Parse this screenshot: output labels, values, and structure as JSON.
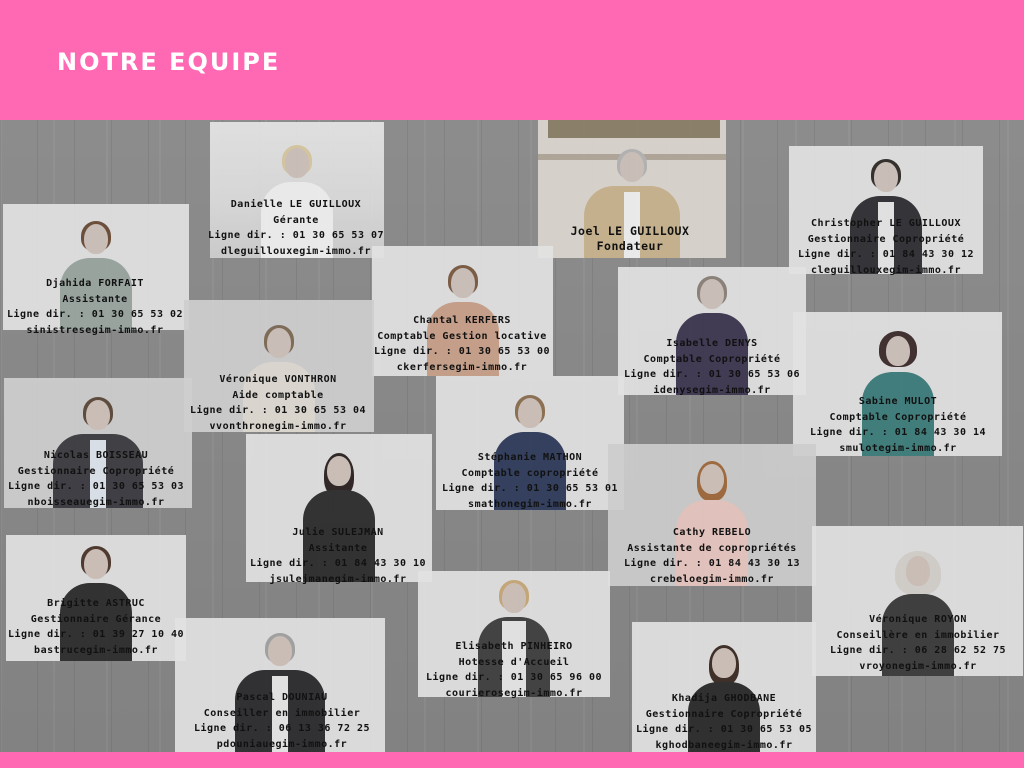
{
  "header": {
    "title": "NOTRE EQUIPE"
  },
  "team": [
    {
      "name": "Danielle LE GUILLOUX",
      "role": "Gérante",
      "phone": "Ligne dir. : 01 30 65 53 07",
      "email": "dleguillouxegim-immo.fr"
    },
    {
      "name": "Joel LE GUILLOUX",
      "role": "Fondateur"
    },
    {
      "name": "Christopher LE GUILLOUX",
      "role": "Gestionnaire Copropriété",
      "phone": "Ligne dir. : 01 84 43 30 12",
      "email": "cleguillouxegim-immo.fr"
    },
    {
      "name": "Djahida FORFAIT",
      "role": "Assistante",
      "phone": "Ligne dir. : 01 30 65 53 02",
      "email": "sinistresegim-immo.fr"
    },
    {
      "name": "Chantal KERFERS",
      "role": "Comptable Gestion locative",
      "phone": "Ligne dir. : 01 30 65 53 00",
      "email": "ckerfersegim-immo.fr"
    },
    {
      "name": "Isabelle DENYS",
      "role": "Comptable Copropriété",
      "phone": "Ligne dir. : 01 30 65 53 06",
      "email": "idenysegim-immo.fr"
    },
    {
      "name": "Véronique VONTHRON",
      "role": "Aide comptable",
      "phone": "Ligne dir. : 01 30 65 53 04",
      "email": "vvonthronegim-immo.fr"
    },
    {
      "name": "Sabine MULOT",
      "role": "Comptable Copropriété",
      "phone": "Ligne dir. : 01 84 43 30 14",
      "email": "smulotegim-immo.fr"
    },
    {
      "name": "Nicolas BOISSEAU",
      "role": "Gestionnaire Copropriété",
      "phone": "Ligne dir. : 01 30 65 53 03",
      "email": "nboisseauegim-immo.fr"
    },
    {
      "name": "Stéphanie MATHON",
      "role": "Comptable copropriété",
      "phone": "Ligne dir. : 01 30 65 53 01",
      "email": "smathonegim-immo.fr"
    },
    {
      "name": "Julie SULEJMAN",
      "role": "Assitante",
      "phone": "Ligne dir. : 01 84 43 30 10",
      "email": "jsulejmanegim-immo.fr"
    },
    {
      "name": "Cathy REBELO",
      "role": "Assistante de copropriétés",
      "phone": "Ligne dir. : 01 84 43 30 13",
      "email": "crebeloegim-immo.fr"
    },
    {
      "name": "Brigitte ASTRUC",
      "role": "Gestionnaire Gérance",
      "phone": "Ligne dir. : 01 39 27 10 40",
      "email": "bastrucegim-immo.fr"
    },
    {
      "name": "Véronique ROYON",
      "role": "Conseillère en immobilier",
      "phone": "Ligne dir. : 06 28 62 52 75",
      "email": "vroyonegim-immo.fr"
    },
    {
      "name": "Elisabeth PINHEIRO",
      "role": "Hotesse d'Accueil",
      "phone": "Ligne dir. : 01 30 65 96 00",
      "email": "courierosegim-immo.fr"
    },
    {
      "name": "Pascal DOUNIAU",
      "role": "Conseiller en immobilier",
      "phone": "Ligne dir. : 06 13 36 72 25",
      "email": "pdouniauegim-immo.fr"
    },
    {
      "name": "Khadija GHODBANE",
      "role": "Gestionnaire Copropriété",
      "phone": "Ligne dir. : 01 30 65 53 05",
      "email": "kghodbaneegim-immo.fr"
    }
  ]
}
